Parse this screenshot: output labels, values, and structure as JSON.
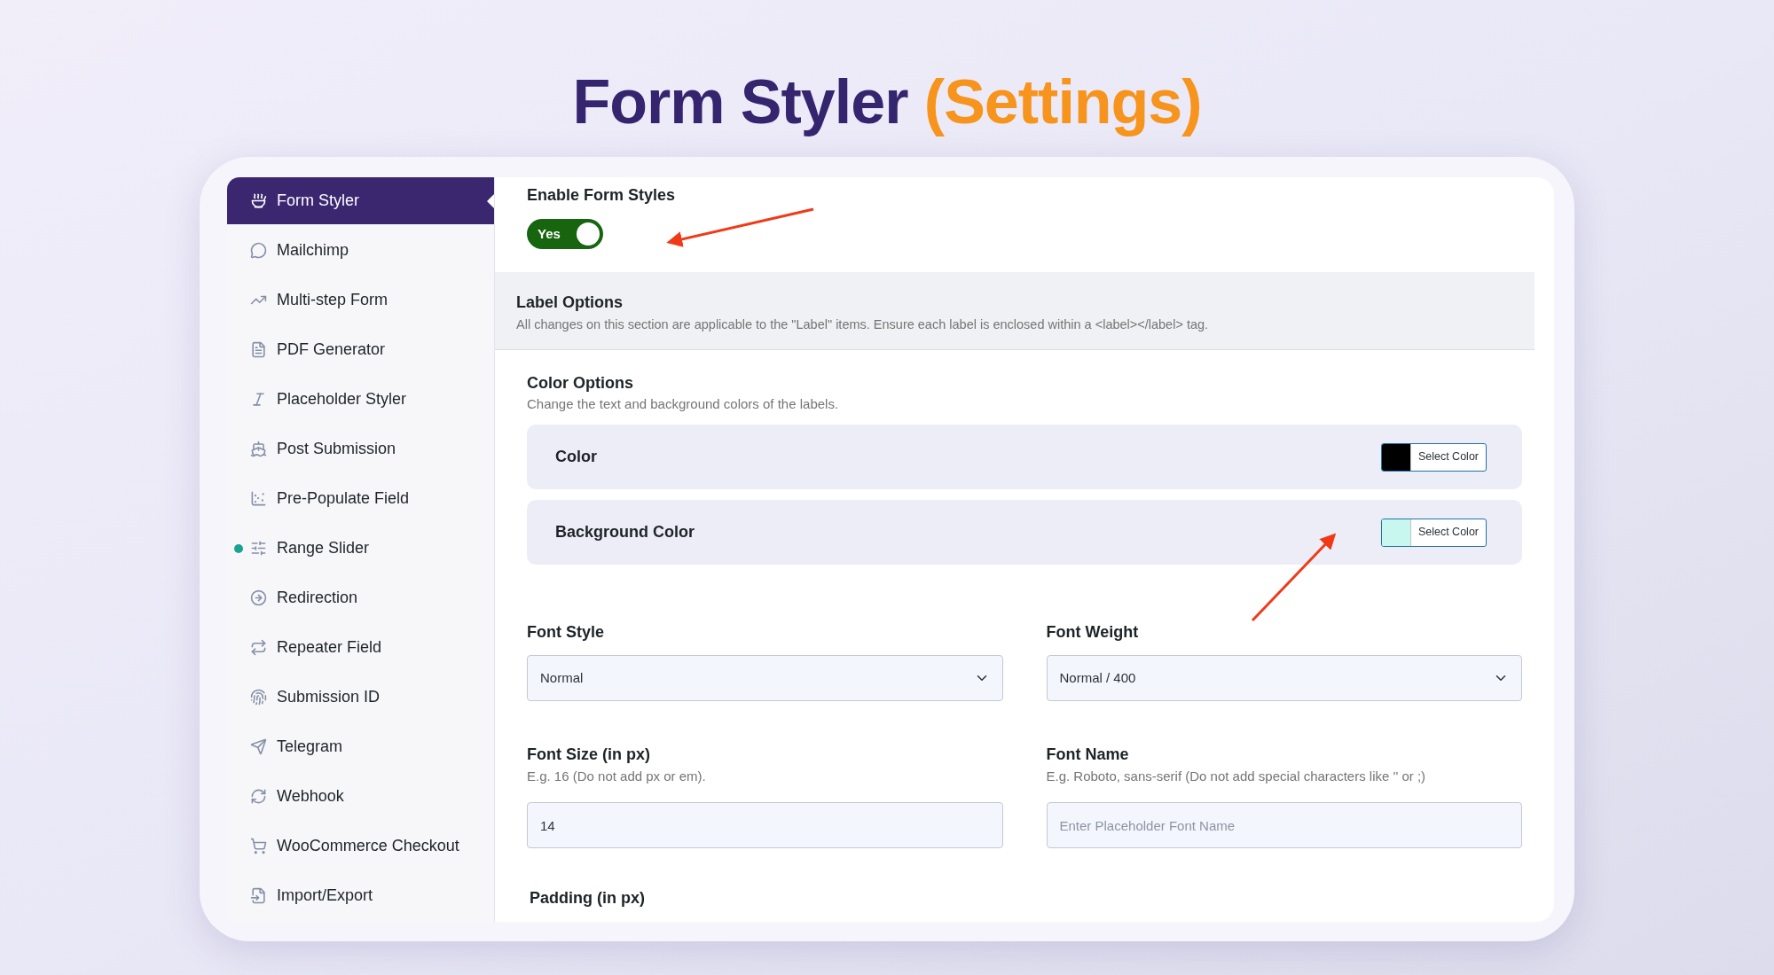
{
  "headline": {
    "main": "Form Styler",
    "accent": "(Settings)"
  },
  "sidebar": {
    "items": [
      {
        "label": "Form Styler",
        "selected": true,
        "dot": false
      },
      {
        "label": "Mailchimp",
        "selected": false,
        "dot": false
      },
      {
        "label": "Multi-step Form",
        "selected": false,
        "dot": false
      },
      {
        "label": "PDF Generator",
        "selected": false,
        "dot": false
      },
      {
        "label": "Placeholder Styler",
        "selected": false,
        "dot": false
      },
      {
        "label": "Post Submission",
        "selected": false,
        "dot": false
      },
      {
        "label": "Pre-Populate Field",
        "selected": false,
        "dot": false
      },
      {
        "label": "Range Slider",
        "selected": false,
        "dot": true
      },
      {
        "label": "Redirection",
        "selected": false,
        "dot": false
      },
      {
        "label": "Repeater Field",
        "selected": false,
        "dot": false
      },
      {
        "label": "Submission ID",
        "selected": false,
        "dot": false
      },
      {
        "label": "Telegram",
        "selected": false,
        "dot": false
      },
      {
        "label": "Webhook",
        "selected": false,
        "dot": false
      },
      {
        "label": "WooCommerce Checkout",
        "selected": false,
        "dot": false
      },
      {
        "label": "Import/Export",
        "selected": false,
        "dot": false
      }
    ]
  },
  "enable": {
    "label": "Enable Form Styles",
    "on": true,
    "text": "Yes"
  },
  "label_options": {
    "title": "Label Options",
    "description": "All changes on this section are applicable to the \"Label\" items. Ensure each label is enclosed within a <label></label> tag."
  },
  "color_options": {
    "title": "Color Options",
    "description": "Change the text and background colors of the labels.",
    "rows": [
      {
        "label": "Color",
        "color": "#000000",
        "button": "Select Color"
      },
      {
        "label": "Background Color",
        "color": "#c8f7ef",
        "button": "Select Color"
      }
    ]
  },
  "fields": [
    {
      "kind": "select",
      "label": "Font Style",
      "value": "Normal"
    },
    {
      "kind": "select",
      "label": "Font Weight",
      "value": "Normal / 400"
    },
    {
      "kind": "input",
      "label": "Font Size (in px)",
      "hint": "E.g. 16 (Do not add px or em).",
      "value": "14"
    },
    {
      "kind": "input",
      "label": "Font Name",
      "hint": "E.g. Roboto, sans-serif (Do not add special characters like '' or ;)",
      "placeholder": "Enter Placeholder Font Name"
    }
  ],
  "next_section": {
    "label": "Padding (in px)"
  }
}
